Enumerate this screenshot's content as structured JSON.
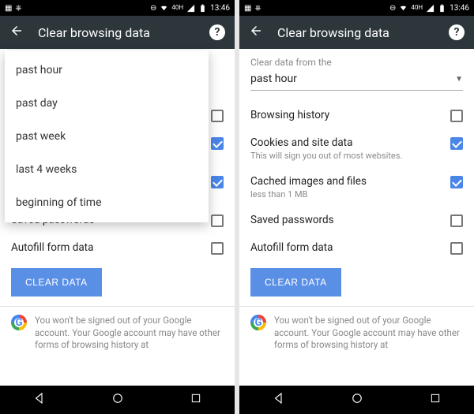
{
  "status": {
    "time": "13:46",
    "signal_label": "40",
    "signal_sub": "H"
  },
  "appbar": {
    "title": "Clear browsing data"
  },
  "section_label": "Clear data from the",
  "dropdown": {
    "selected": "past hour",
    "options": [
      "past hour",
      "past day",
      "past week",
      "last 4 weeks",
      "beginning of time"
    ]
  },
  "items": [
    {
      "label": "Browsing history",
      "sub": "",
      "checked": false
    },
    {
      "label": "Cookies and site data",
      "sub": "This will sign you out of most websites.",
      "checked": true
    },
    {
      "label": "Cached images and files",
      "sub": "less than 1 MB",
      "checked": true
    },
    {
      "label": "Saved passwords",
      "sub": "",
      "checked": false
    },
    {
      "label": "Autofill form data",
      "sub": "",
      "checked": false
    }
  ],
  "clear_button": "CLEAR DATA",
  "footer_note": "You won't be signed out of your Google account. Your Google account may have other forms of browsing history at"
}
